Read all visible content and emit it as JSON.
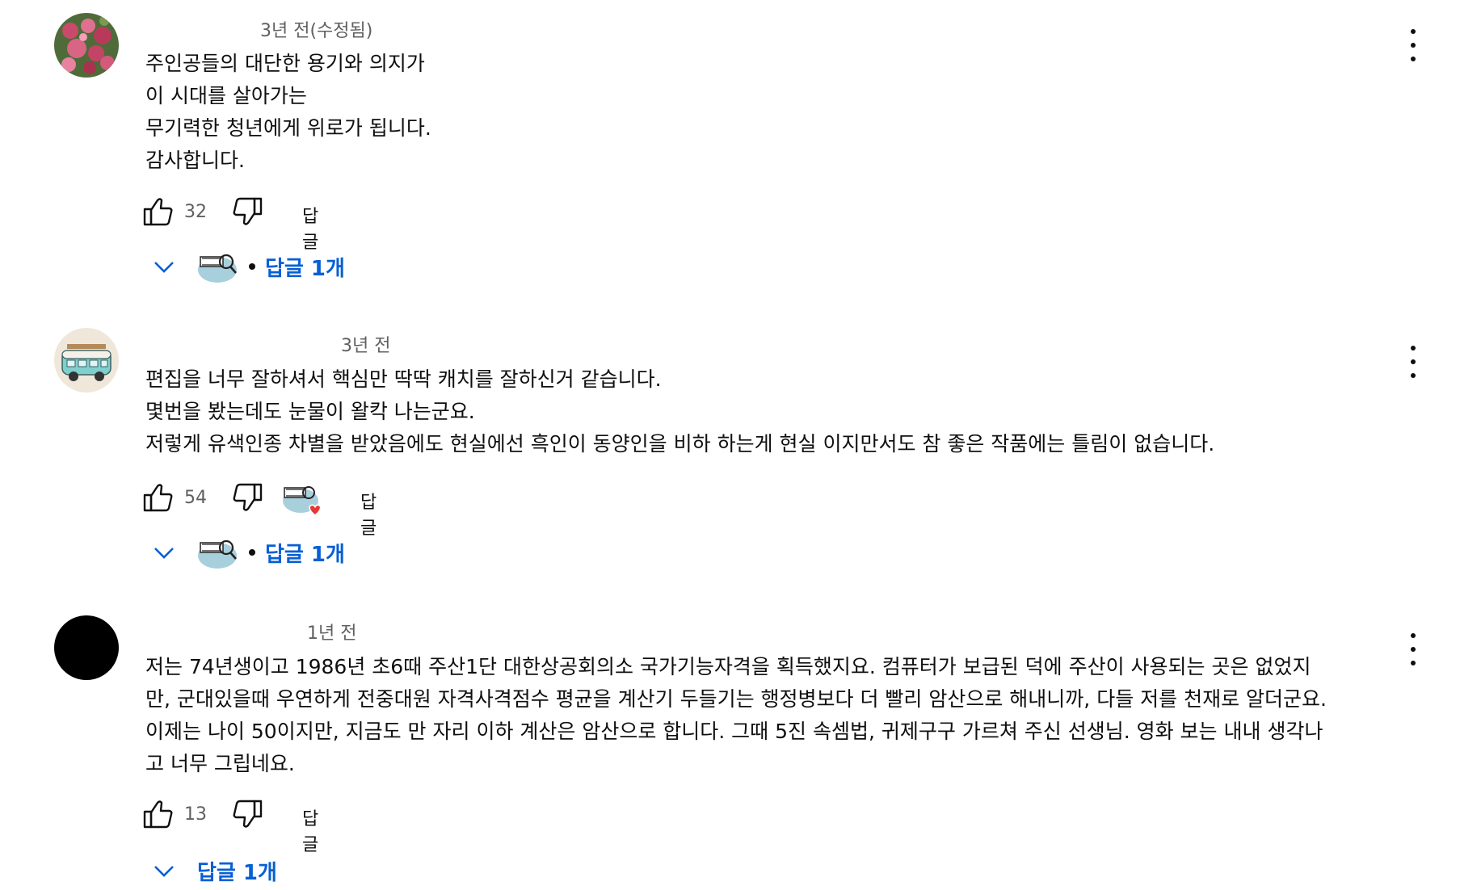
{
  "colors": {
    "link": "#065fd4",
    "meta": "#606060",
    "text": "#0f0f0f",
    "heart": "#e53935"
  },
  "comments": [
    {
      "avatar": "flower-photo-avatar",
      "time": "3년 전(수정됨)",
      "text": "주인공들의 대단한 용기와 의지가\n이 시대를 살아가는\n무기력한 청년에게 위로가 됩니다.\n감사합니다.",
      "likes": "32",
      "reply_label": "답글",
      "replies_label": "답글 1개",
      "creator_heart": false
    },
    {
      "avatar": "van-illustration-avatar",
      "time": "3년 전",
      "text": "편집을 너무 잘하셔서 핵심만 딱딱 캐치를 잘하신거 같습니다.\n몇번을 봤는데도 눈물이 왈칵 나는군요.\n저렇게 유색인종 차별을 받았음에도 현실에선 흑인이 동양인을 비하 하는게 현실 이지만서도 참 좋은 작품에는 틀림이 없습니다.",
      "likes": "54",
      "reply_label": "답글",
      "replies_label": "답글 1개",
      "creator_heart": true
    },
    {
      "avatar": "black-circle-avatar",
      "time": "1년 전",
      "text": "저는 74년생이고 1986년 초6때 주산1단 대한상공회의소 국가기능자격을 획득했지요. 컴퓨터가 보급된 덕에 주산이 사용되는 곳은 없었지\n만, 군대있을때 우연하게 전중대원 자격사격점수 평균을 계산기 두들기는 행정병보다 더 빨리 암산으로 해내니까, 다들 저를 천재로 알더군요.\n이제는 나이 50이지만, 지금도 만 자리 이하 계산은 암산으로 합니다. 그때 5진 속셈법, 귀제구구 가르쳐 주신 선생님. 영화 보는 내내 생각나\n고 너무 그립네요.",
      "likes": "13",
      "reply_label": "답글",
      "replies_label": "답글 1개",
      "creator_heart": false
    }
  ]
}
